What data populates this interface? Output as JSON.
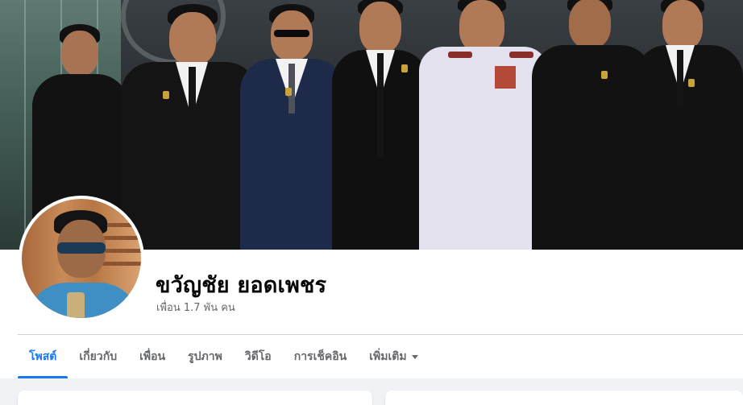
{
  "profile": {
    "name": "ขวัญชัย ยอดเพชร",
    "friends_text": "เพื่อน 1.7 พัน คน"
  },
  "cover": {
    "description_icon": "group-photo"
  },
  "tabs": [
    {
      "label": "โพสต์",
      "active": true
    },
    {
      "label": "เกี่ยวกับ",
      "active": false
    },
    {
      "label": "เพื่อน",
      "active": false
    },
    {
      "label": "รูปภาพ",
      "active": false
    },
    {
      "label": "วิดีโอ",
      "active": false
    },
    {
      "label": "การเช็คอิน",
      "active": false
    },
    {
      "label": "เพิ่มเติม",
      "active": false
    }
  ],
  "panels": {
    "left_title": "",
    "right_title": ""
  },
  "colors": {
    "accent": "#1877f2",
    "page_bg": "#f0f2f5",
    "muted_text": "#65676b"
  }
}
